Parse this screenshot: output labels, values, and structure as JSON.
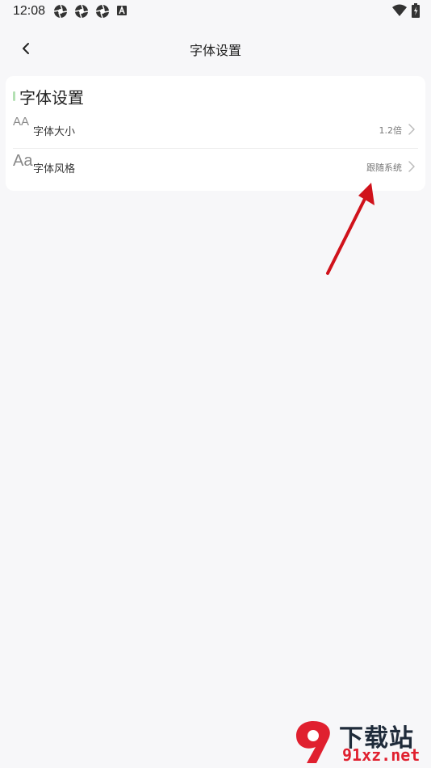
{
  "status_bar": {
    "time": "12:08",
    "left_icons": [
      "aperture-icon",
      "aperture-icon",
      "aperture-icon",
      "a-badge-icon"
    ],
    "right_icons": [
      "wifi-icon",
      "battery-charging-icon"
    ]
  },
  "app_bar": {
    "title": "字体设置",
    "back_icon": "chevron-left-icon"
  },
  "card": {
    "title": "字体设置",
    "accent_color": "#b3e0b3",
    "rows": [
      {
        "icon_text": "AA",
        "label": "字体大小",
        "value": "1.2倍"
      },
      {
        "icon_text": "Aa",
        "label": "字体风格",
        "value": "跟随系统"
      }
    ]
  },
  "watermark": {
    "big_text": "下载站",
    "small_text": "91xz.net",
    "brand_color": "#e0202f"
  }
}
